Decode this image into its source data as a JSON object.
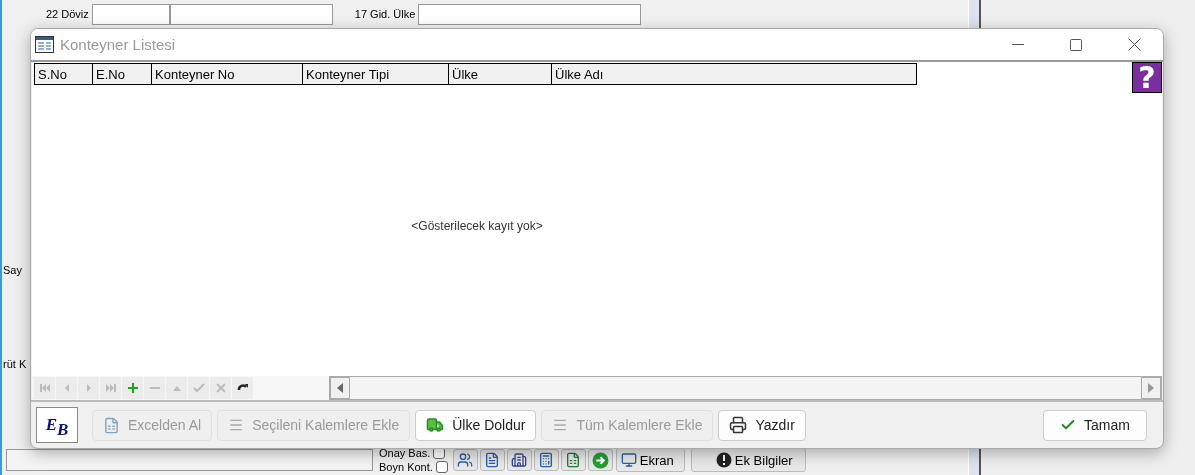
{
  "background_form": {
    "top_fields": [
      {
        "label": "22 Döviz",
        "fields": [
          {
            "kind": "short"
          },
          {
            "kind": "long"
          }
        ]
      },
      {
        "label": "17 Gid. Ülke",
        "fields": [
          {
            "kind": "wide"
          }
        ]
      }
    ],
    "side_labels": [
      "Say",
      "rüt K"
    ],
    "checkboxes": [
      {
        "label": "Onay Bas.",
        "checked": false
      },
      {
        "label": "Boyn Kont.",
        "checked": false
      }
    ],
    "toolbar_icons": [
      {
        "kind": "users"
      },
      {
        "kind": "list"
      },
      {
        "kind": "building"
      },
      {
        "kind": "calculator"
      },
      {
        "kind": "excel"
      },
      {
        "kind": "go"
      }
    ],
    "toolbar_buttons": [
      {
        "kind": "monitor",
        "label": "Ekran"
      },
      {
        "kind": "info",
        "label": "Ek Bilgiler"
      }
    ]
  },
  "dialog": {
    "title": "Konteyner Listesi",
    "help": "?",
    "table": {
      "columns": [
        "S.No",
        "E.No",
        "Konteyner No",
        "Konteyner Tipi",
        "Ülke",
        "Ülke Adı"
      ],
      "empty_text": "<Gösterilecek kayıt yok>"
    },
    "navigator": [
      {
        "kind": "first",
        "disabled": true
      },
      {
        "kind": "prev",
        "disabled": true
      },
      {
        "kind": "next",
        "disabled": true
      },
      {
        "kind": "last",
        "disabled": true
      },
      {
        "kind": "insert",
        "disabled": false
      },
      {
        "kind": "delete",
        "disabled": true
      },
      {
        "kind": "edit",
        "disabled": true
      },
      {
        "kind": "post",
        "disabled": true
      },
      {
        "kind": "cancel",
        "disabled": true
      },
      {
        "kind": "refresh",
        "disabled": false
      }
    ],
    "logo": "EB",
    "buttons": [
      {
        "kind": "excel",
        "label": "Excelden Al",
        "disabled": true
      },
      {
        "kind": "lines",
        "label": "Seçileni Kalemlere Ekle",
        "disabled": true
      },
      {
        "kind": "truck",
        "label": "Ülke Doldur",
        "disabled": false
      },
      {
        "kind": "lines",
        "label": "Tüm Kalemlere Ekle",
        "disabled": true
      },
      {
        "kind": "print",
        "label": "Yazdır",
        "disabled": false
      }
    ],
    "ok_button": {
      "kind": "check",
      "label": "Tamam"
    }
  }
}
